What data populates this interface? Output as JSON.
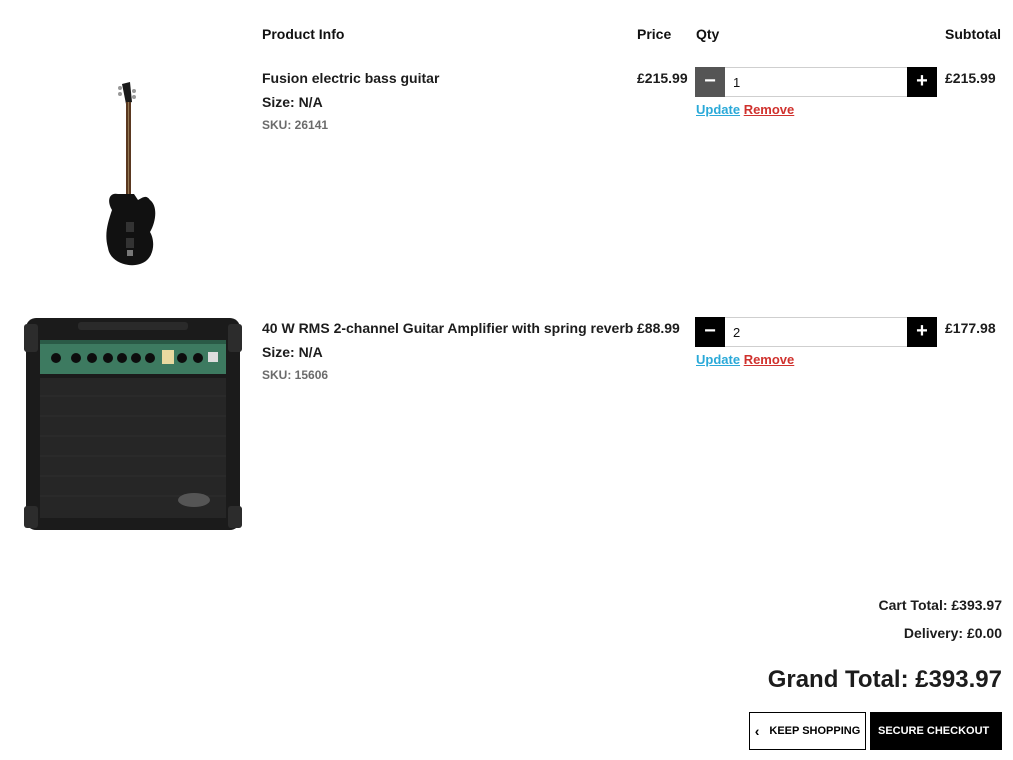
{
  "cart": {
    "headers": {
      "product_info": "Product Info",
      "price": "Price",
      "qty": "Qty",
      "subtotal": "Subtotal"
    },
    "items": [
      {
        "name": "Fusion electric bass guitar",
        "size": "Size: N/A",
        "sku": "SKU: 26141",
        "price": "£215.99",
        "qty": "1",
        "subtotal": "£215.99",
        "image": "bass-guitar-image",
        "minus_color": "#555555"
      },
      {
        "name": "40 W RMS 2-channel Guitar Amplifier with spring reverb",
        "size": "Size: N/A",
        "sku": "SKU: 15606",
        "price": "£88.99",
        "qty": "2",
        "subtotal": "£177.98",
        "image": "guitar-amplifier-image",
        "minus_color": "#000000"
      }
    ],
    "update_label": "Update",
    "remove_label": "Remove",
    "update_color": "#2aa9d8",
    "remove_color": "#d0312d"
  },
  "summary": {
    "cart_total": "Cart Total: £393.97",
    "delivery": "Delivery: £0.00",
    "grand_total": "Grand Total: £393.97"
  },
  "actions": {
    "keep_shopping": "KEEP SHOPPING",
    "secure_checkout": "SECURE CHECKOUT"
  }
}
